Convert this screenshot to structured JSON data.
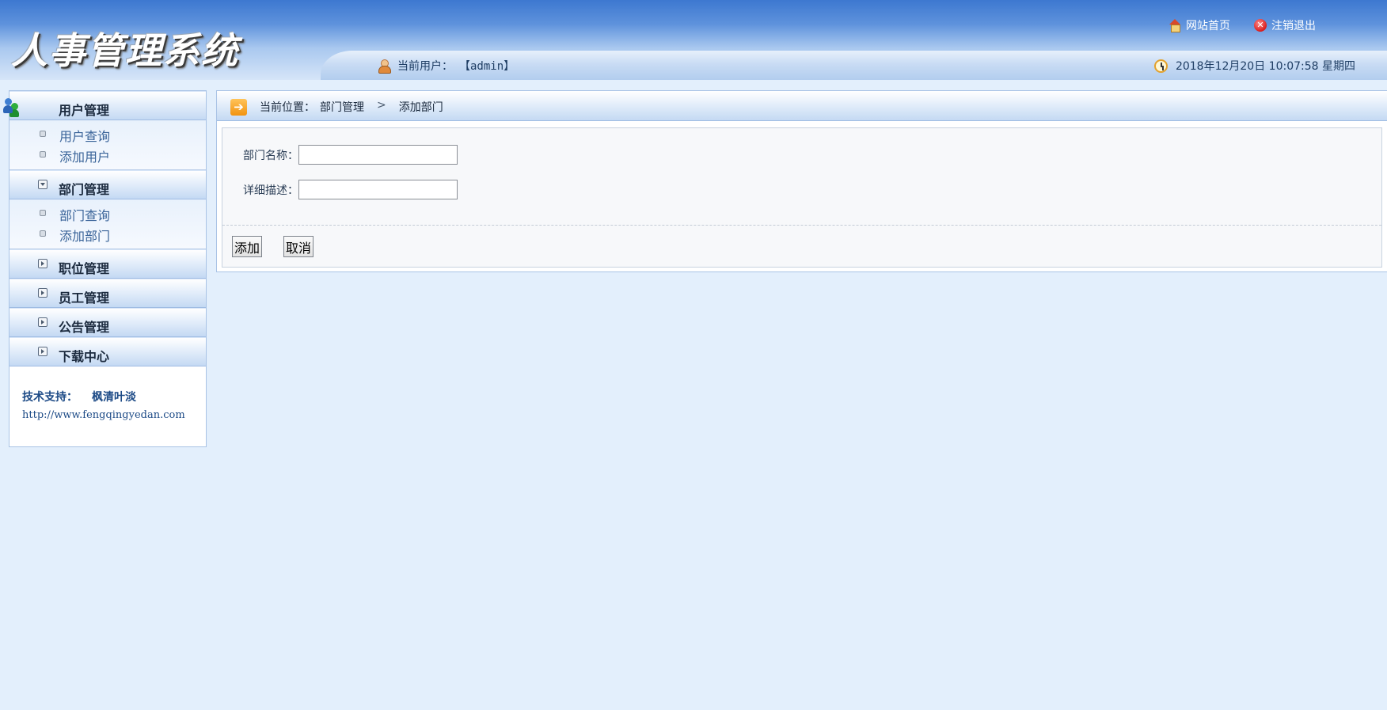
{
  "header": {
    "logo_text": "人事管理系统",
    "home_link": "网站首页",
    "logout_link": "注销退出",
    "current_user_label": "当前用户：",
    "current_user_name": "【admin】",
    "datetime": "2018年12月20日 10:07:58 星期四"
  },
  "sidebar": {
    "sections": [
      {
        "label": "用户管理",
        "items": [
          "用户查询",
          "添加用户"
        ]
      },
      {
        "label": "部门管理",
        "items": [
          "部门查询",
          "添加部门"
        ]
      },
      {
        "label": "职位管理"
      },
      {
        "label": "员工管理"
      },
      {
        "label": "公告管理"
      },
      {
        "label": "下载中心"
      }
    ],
    "support": {
      "label": "技术支持：",
      "name": "枫清叶淡",
      "url": "http://www.fengqingyedan.com"
    }
  },
  "main": {
    "breadcrumb": {
      "prefix": "当前位置：",
      "section": "部门管理",
      "separator": ">",
      "page": "添加部门"
    },
    "form": {
      "dept_name_label": "部门名称：",
      "dept_name_value": "",
      "description_label": "详细描述：",
      "description_value": "",
      "add_button": "添加",
      "cancel_button": "取消"
    }
  }
}
